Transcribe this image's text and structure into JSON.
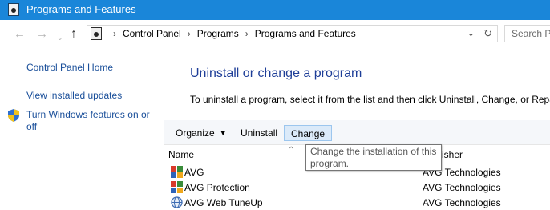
{
  "window": {
    "title": "Programs and Features",
    "icon": "control-panel-icon"
  },
  "nav": {
    "back_icon": "back-arrow-icon",
    "forward_icon": "forward-arrow-icon",
    "recent_icon": "chevron-down-icon",
    "up_icon": "up-arrow-icon",
    "breadcrumbs": [
      "Control Panel",
      "Programs",
      "Programs and Features"
    ],
    "search_placeholder": "Search Pr"
  },
  "sidebar": {
    "home": "Control Panel Home",
    "updates": "View installed updates",
    "features": "Turn Windows features on or off"
  },
  "main": {
    "heading": "Uninstall or change a program",
    "description": "To uninstall a program, select it from the list and then click Uninstall, Change, or Repa"
  },
  "toolbar": {
    "organize": "Organize",
    "uninstall": "Uninstall",
    "change": "Change"
  },
  "columns": {
    "name": "Name",
    "publisher": "Publisher"
  },
  "programs": [
    {
      "name": "AVG",
      "publisher": "AVG Technologies",
      "icon": "avg-icon"
    },
    {
      "name": "AVG Protection",
      "publisher": "AVG Technologies",
      "icon": "avg-icon"
    },
    {
      "name": "AVG Web TuneUp",
      "publisher": "AVG Technologies",
      "icon": "avg-web-tuneup-icon"
    }
  ],
  "tooltip": {
    "text": "Change the installation of this program."
  },
  "colors": {
    "titlebar": "#1a86d9",
    "link": "#1a4f9a",
    "heading": "#1e3e98",
    "selected_button": "#dbeaf9"
  }
}
